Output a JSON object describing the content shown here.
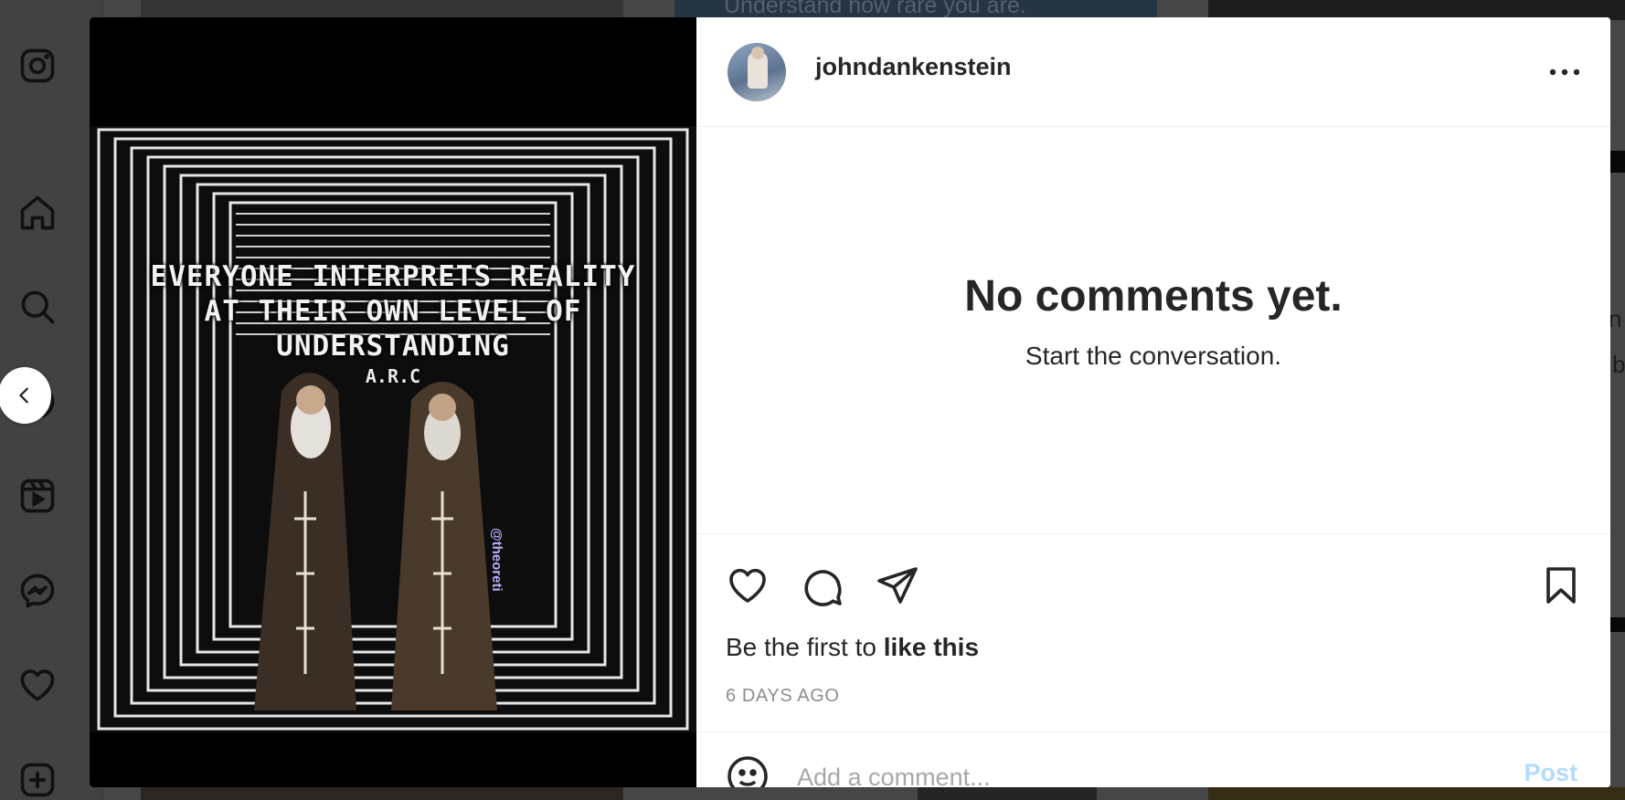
{
  "sidebar": {
    "items": [
      {
        "name": "instagram-logo-icon"
      },
      {
        "name": "home-icon"
      },
      {
        "name": "search-icon"
      },
      {
        "name": "explore-icon"
      },
      {
        "name": "reels-icon"
      },
      {
        "name": "messenger-icon"
      },
      {
        "name": "heart-icon"
      },
      {
        "name": "create-icon"
      }
    ]
  },
  "background": {
    "top_text": "Understand how rare you are.",
    "right_text_1": "n",
    "right_text_2": "b"
  },
  "post": {
    "username": "johndankenstein",
    "image_text_line1": "EVERYONE INTERPRETS REALITY",
    "image_text_line2": "AT THEIR OWN LEVEL OF",
    "image_text_line3": "UNDERSTANDING",
    "image_signature": "A.R.C",
    "image_watermark": "@theoreti"
  },
  "comments": {
    "empty_title": "No comments yet.",
    "empty_subtitle": "Start the conversation."
  },
  "likes": {
    "prefix": "Be the first to ",
    "link": "like this"
  },
  "timestamp": "6 DAYS AGO",
  "add_comment": {
    "placeholder": "Add a comment...",
    "post_label": "Post"
  },
  "colors": {
    "text_primary": "#262626",
    "text_secondary": "#8e8e8e",
    "post_disabled": "#b3dbff",
    "divider": "#efefef"
  }
}
